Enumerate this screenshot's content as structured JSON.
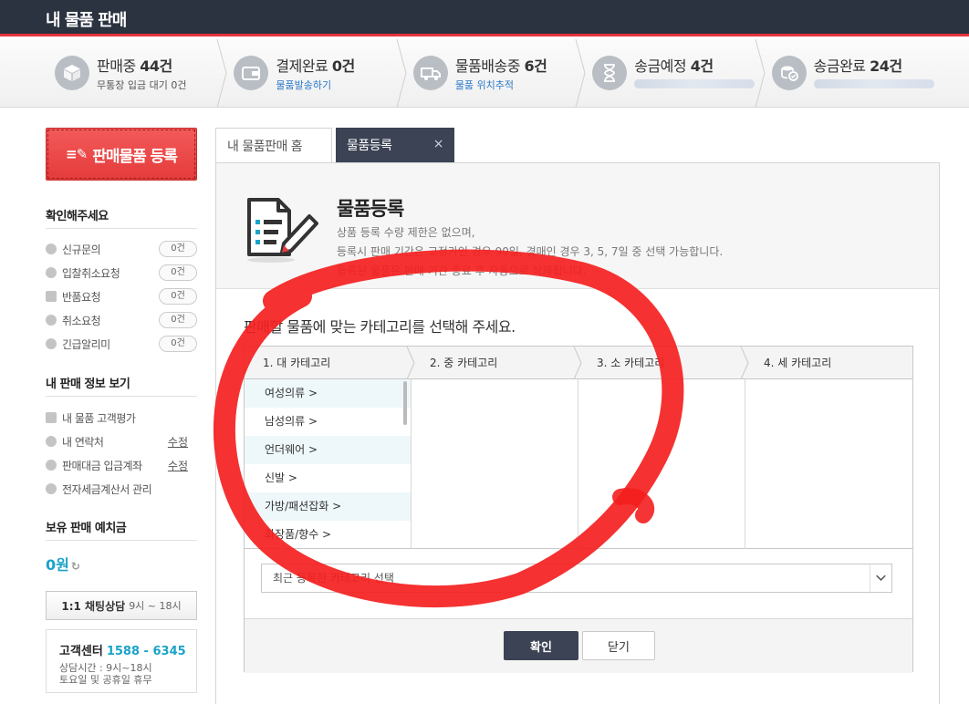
{
  "header": {
    "title": "내 물품 판매"
  },
  "status_steps": [
    {
      "label": "판매중 ",
      "count": "44건",
      "sub": "무통장 입금 대기 0건",
      "sub_link": false
    },
    {
      "label": "결제완료 ",
      "count": "0건",
      "sub": "물품발송하기",
      "sub_link": true
    },
    {
      "label": "물품배송중 ",
      "count": "6건",
      "sub": "물품 위치추적",
      "sub_link": true
    },
    {
      "label": "송금예정 ",
      "count": "4건",
      "sub": "",
      "sub_link": false
    },
    {
      "label": "송금완료 ",
      "count": "24건",
      "sub": "",
      "sub_link": false
    }
  ],
  "sidebar": {
    "register_button": "판매물품 등록",
    "check_title": "확인해주세요",
    "check_items": [
      {
        "label": "신규문의",
        "count": "0건"
      },
      {
        "label": "입찰취소요청",
        "count": "0건"
      },
      {
        "label": "반품요청",
        "count": "0건"
      },
      {
        "label": "취소요청",
        "count": "0건"
      },
      {
        "label": "긴급알리미",
        "count": "0건"
      }
    ],
    "info_title": "내 판매 정보 보기",
    "info_items": [
      {
        "label": "내 물품 고객평가",
        "action": ""
      },
      {
        "label": "내 연락처",
        "action": "수정"
      },
      {
        "label": "판매대금 입금계좌",
        "action": "수정"
      },
      {
        "label": "전자세금계산서 관리",
        "action": ""
      }
    ],
    "deposit_title": "보유 판매 예치금",
    "deposit_value": "0원",
    "chat_label": "1:1 채팅상담",
    "chat_hours": "9시 ~ 18시",
    "cs_label": "고객센터",
    "cs_number": "1588 - 6345",
    "cs_hours_1": "상담시간 : 9시~18시",
    "cs_hours_2": "토요일 및 공휴일 휴무"
  },
  "tabs": {
    "home": "내 물품판매 홈",
    "active": "물품등록",
    "close": "×"
  },
  "panel": {
    "title": "물품등록",
    "desc_1": "상품 등록 수량 제한은 없으며,",
    "desc_2": "등록시 판매 기간은 고정가인 경우 90일, 경매인 경우 3, 5, 7일 중 선택 가능합니다.",
    "desc_3": "등록된 물품은 판매 기간 종료 후 자동으로 삭제됩니다.",
    "prompt": "판매할 물품에 맞는 카테고리를 선택해 주세요.",
    "category_headers": [
      "1. 대 카테고리",
      "2. 중 카테고리",
      "3. 소 카테고리",
      "4. 세 카테고리"
    ],
    "categories": [
      "여성의류 >",
      "남성의류 >",
      "언더웨어 >",
      "신발 >",
      "가방/패션잡화 >",
      "화장품/향수 >"
    ],
    "recent_select": "최근 등록한 카테고리 선택",
    "ok_button": "확인",
    "close_button": "닫기"
  },
  "colors": {
    "accent_red": "#e53b3b",
    "nav_dark": "#2b3240",
    "tab_dark": "#3b4354",
    "link_blue": "#2a79c8",
    "teal": "#1aa3c9"
  }
}
